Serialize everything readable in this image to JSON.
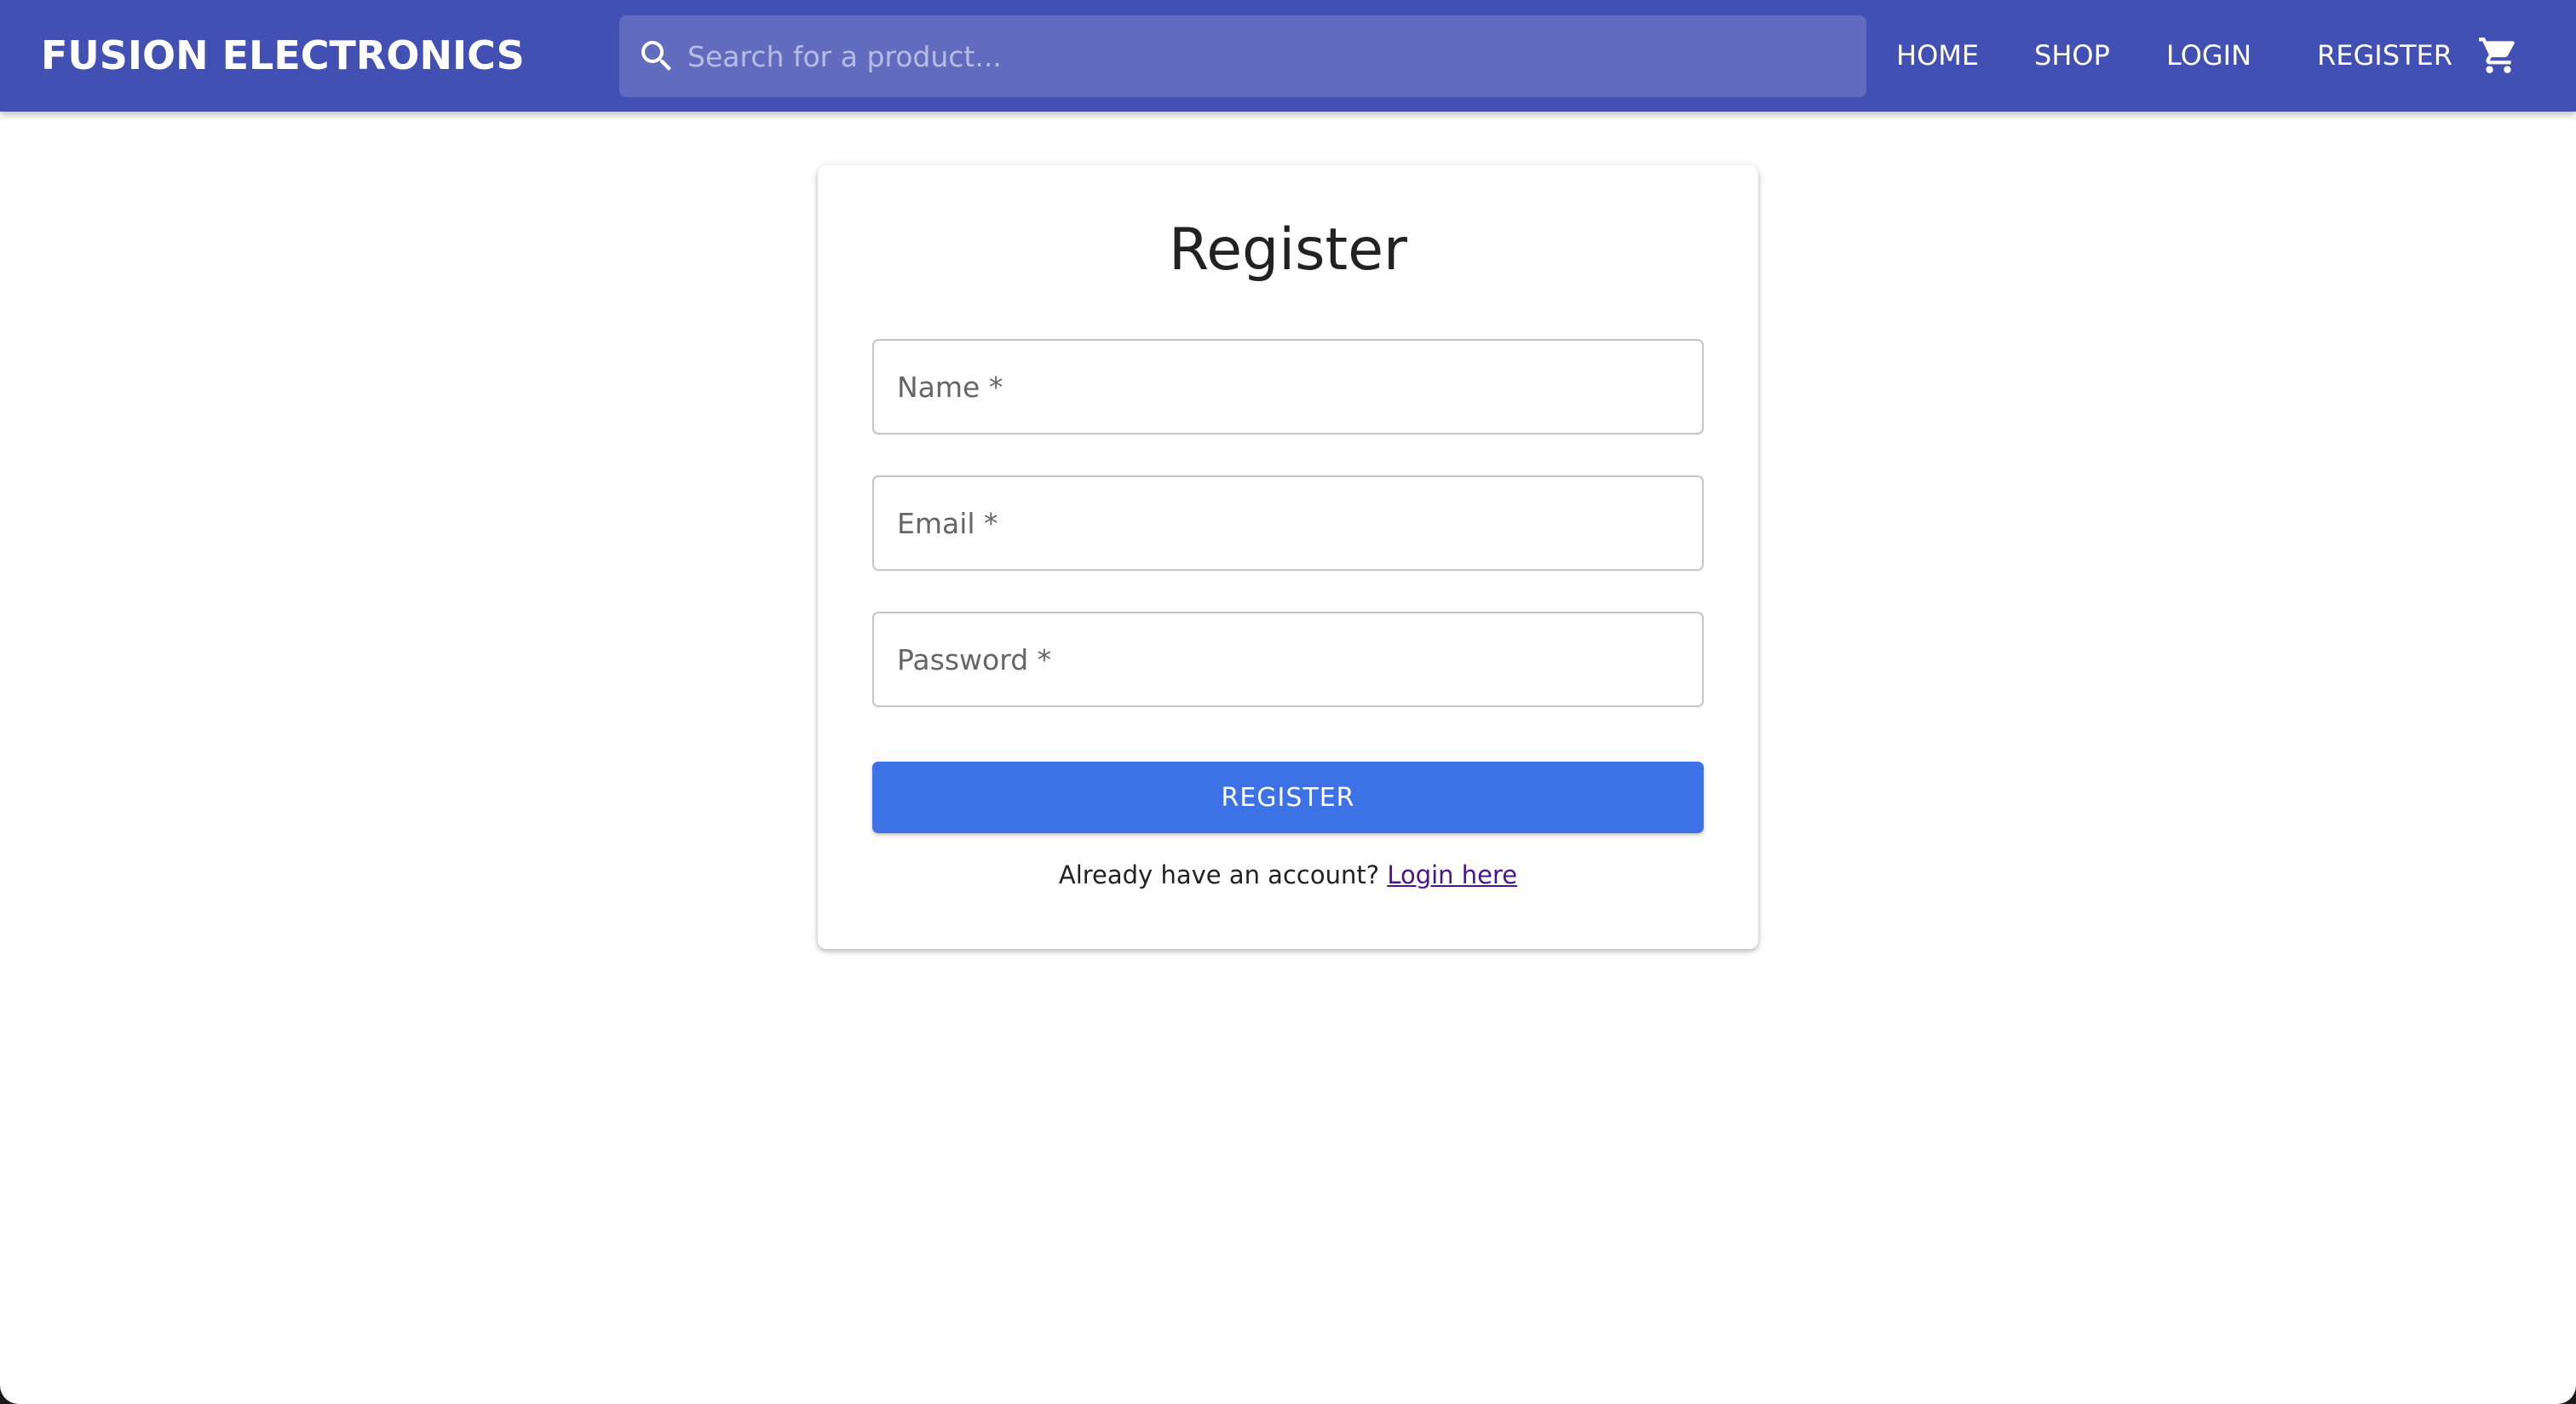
{
  "header": {
    "brand": "FUSION ELECTRONICS",
    "search": {
      "placeholder": "Search for a product...",
      "icon": "search-icon"
    },
    "nav": {
      "home": "HOME",
      "shop": "SHOP",
      "login": "LOGIN",
      "register": "REGISTER"
    },
    "cart_icon": "shopping-cart-icon",
    "background_color": "#4350b3"
  },
  "register_form": {
    "title": "Register",
    "fields": {
      "name_placeholder": "Name *",
      "email_placeholder": "Email *",
      "password_placeholder": "Password *"
    },
    "submit_label": "REGISTER",
    "submit_color": "#3d72e6",
    "footer_text": "Already have an account?",
    "login_link": "Login here"
  }
}
